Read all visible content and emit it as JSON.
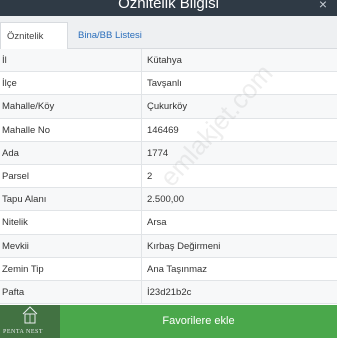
{
  "header": {
    "title": "Öznitelik Bilgisi",
    "close": "×"
  },
  "tabs": [
    {
      "label": "Öznitelik Bilgisi",
      "active": true
    },
    {
      "label": "Bina/BB Listesi",
      "active": false
    }
  ],
  "rows": [
    {
      "key": "İl",
      "value": "Kütahya"
    },
    {
      "key": "İlçe",
      "value": "Tavşanlı"
    },
    {
      "key": "Mahalle/Köy",
      "value": "Çukurköy"
    },
    {
      "key": "Mahalle No",
      "value": "146469"
    },
    {
      "key": "Ada",
      "value": "1774"
    },
    {
      "key": "Parsel",
      "value": "2"
    },
    {
      "key": "Tapu Alanı",
      "value": "2.500,00"
    },
    {
      "key": "Nitelik",
      "value": "Arsa"
    },
    {
      "key": "Mevkii",
      "value": "Kırbaş Değirmeni"
    },
    {
      "key": "Zemin Tip",
      "value": "Ana Taşınmaz"
    },
    {
      "key": "Pafta",
      "value": "İ23d21b2c"
    }
  ],
  "watermark": "emlakjet.com",
  "footer": {
    "button_label": "Favorilere ekle"
  },
  "logo": {
    "text": "PENTA NEST"
  }
}
